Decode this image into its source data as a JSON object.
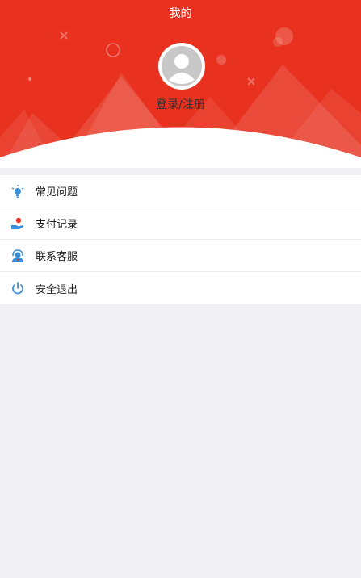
{
  "header": {
    "title": "我的",
    "login_label": "登录/注册",
    "accent_color": "#e8321f"
  },
  "menu": {
    "items": [
      {
        "label": "常见问题",
        "icon": "lightbulb-icon"
      },
      {
        "label": "支付记录",
        "icon": "payment-hand-icon"
      },
      {
        "label": "联系客服",
        "icon": "customer-service-icon"
      },
      {
        "label": "安全退出",
        "icon": "power-icon"
      }
    ]
  }
}
